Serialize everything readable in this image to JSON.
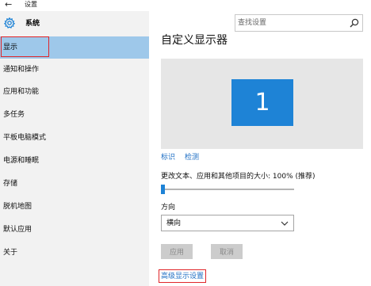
{
  "titlebar": {
    "back_icon": "back-arrow-icon",
    "title": "设置"
  },
  "sidebar": {
    "header_icon": "gear-icon",
    "header_label": "系统",
    "selected_index": 0,
    "items": [
      {
        "label": "显示"
      },
      {
        "label": "通知和操作"
      },
      {
        "label": "应用和功能"
      },
      {
        "label": "多任务"
      },
      {
        "label": "平板电脑模式"
      },
      {
        "label": "电源和睡眠"
      },
      {
        "label": "存储"
      },
      {
        "label": "脱机地图"
      },
      {
        "label": "默认应用"
      },
      {
        "label": "关于"
      }
    ]
  },
  "search": {
    "placeholder": "查找设置",
    "icon": "search-icon"
  },
  "main": {
    "title": "自定义显示器",
    "monitor_number": "1",
    "identify_link": "标识",
    "detect_link": "检测",
    "scale_label": "更改文本、应用和其他项目的大小: 100% (推荐)",
    "scale_percent": 100,
    "orientation_label": "方向",
    "orientation_value": "横向",
    "apply_button": "应用",
    "cancel_button": "取消",
    "advanced_link": "高级显示设置"
  },
  "colors": {
    "accent": "#1e83d6",
    "selected_bg": "#9ec8ea",
    "sidebar_bg": "#f2f2f2",
    "highlight_outline": "#e0262a",
    "link": "#1f6fc4"
  }
}
